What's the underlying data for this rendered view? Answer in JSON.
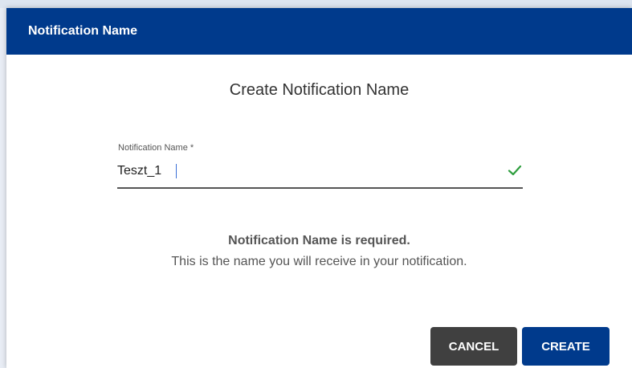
{
  "header": {
    "title": "Notification Name"
  },
  "dialog": {
    "subtitle": "Create Notification Name",
    "field": {
      "label": "Notification Name *",
      "value": "Teszt_1",
      "valid_icon": "check-icon",
      "valid_color": "#2e9e3e"
    },
    "message": {
      "strong": "Notification Name is required.",
      "sub": "This is the name you will receive in your notification."
    },
    "buttons": {
      "cancel_label": "CANCEL",
      "create_label": "CREATE"
    }
  },
  "colors": {
    "header_bg": "#003a8c",
    "cancel_bg": "#404040",
    "create_bg": "#003a8c"
  }
}
